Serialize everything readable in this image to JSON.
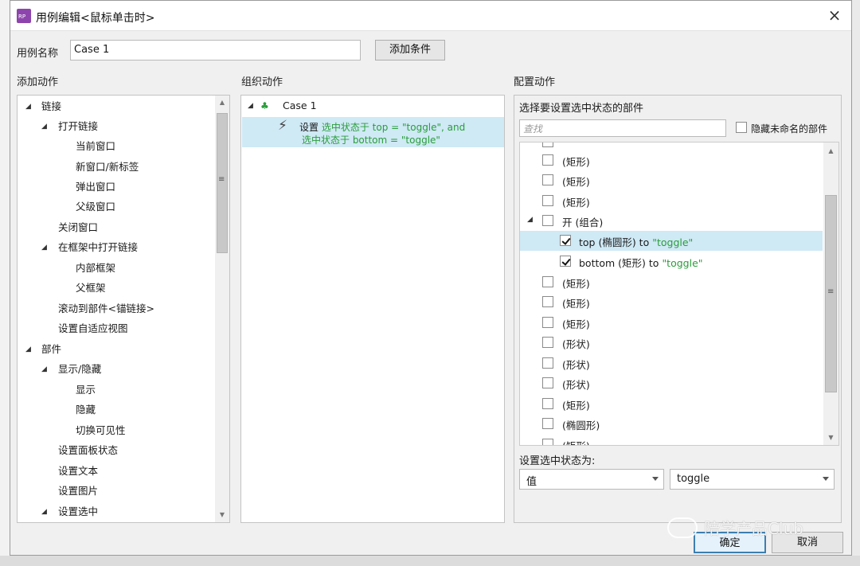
{
  "dialog": {
    "title": "用例编辑<鼠标单击时>",
    "app_icon_text": "RP",
    "close": "×"
  },
  "case_name": {
    "label": "用例名称",
    "value": "Case 1",
    "add_condition": "添加条件"
  },
  "add_actions": {
    "header": "添加动作",
    "items": [
      "链接",
      "打开链接",
      "当前窗口",
      "新窗口/新标签",
      "弹出窗口",
      "父级窗口",
      "关闭窗口",
      "在框架中打开链接",
      "内部框架",
      "父框架",
      "滚动到部件<锚链接>",
      "设置自适应视图",
      "部件",
      "显示/隐藏",
      "显示",
      "隐藏",
      "切换可见性",
      "设置面板状态",
      "设置文本",
      "设置图片",
      "设置选中"
    ]
  },
  "organize_actions": {
    "header": "组织动作",
    "case_label": "Case 1",
    "action_prefix": "设置",
    "action_line1": "选中状态于 top = \"toggle\", and",
    "action_line2": "选中状态于 bottom = \"toggle\""
  },
  "configure_actions": {
    "header": "配置动作",
    "subheader": "选择要设置选中状态的部件",
    "search_placeholder": "查找",
    "hide_unnamed": "隐藏未命名的部件",
    "widgets": [
      {
        "label": "(矩形)",
        "checked": false
      },
      {
        "label": "(矩形)",
        "checked": false
      },
      {
        "label": "(矩形)",
        "checked": false
      },
      {
        "label": "开 (组合)",
        "checked": false
      },
      {
        "label": "top (椭圆形) to ",
        "suffix": "\"toggle\"",
        "checked": true
      },
      {
        "label": "bottom (矩形) to ",
        "suffix": "\"toggle\"",
        "checked": true
      },
      {
        "label": "(矩形)",
        "checked": false
      },
      {
        "label": "(矩形)",
        "checked": false
      },
      {
        "label": "(矩形)",
        "checked": false
      },
      {
        "label": "(形状)",
        "checked": false
      },
      {
        "label": "(形状)",
        "checked": false
      },
      {
        "label": "(形状)",
        "checked": false
      },
      {
        "label": "(矩形)",
        "checked": false
      },
      {
        "label": "(椭圆形)",
        "checked": false
      },
      {
        "label": "(矩形)",
        "checked": false
      }
    ],
    "set_label": "设置选中状态为:",
    "select_type": "值",
    "select_value": "toggle"
  },
  "footer": {
    "ok": "确定",
    "cancel": "取消",
    "watermark": "陪学产品Club"
  }
}
